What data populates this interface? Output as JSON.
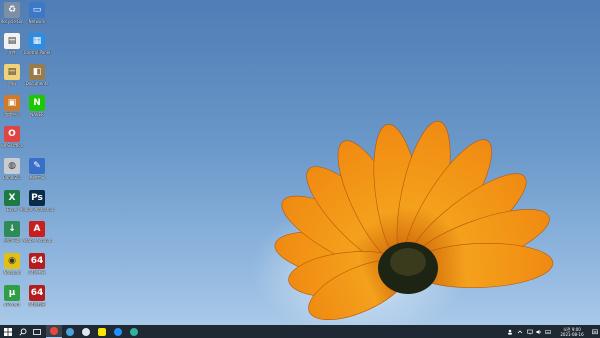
{
  "desktop": {
    "icons": [
      {
        "label": "Recycle Bin",
        "color": "#7f8fa3",
        "glyph": "♻"
      },
      {
        "label": "Network",
        "color": "#3b78c8",
        "glyph": "▭"
      },
      {
        "label": "文件",
        "color": "#f2f2f2",
        "glyph": "▤"
      },
      {
        "label": "Control Panel",
        "color": "#2d8de0",
        "glyph": "▦"
      },
      {
        "label": "资料",
        "color": "#f0d27a",
        "glyph": "▤"
      },
      {
        "label": "Documents",
        "color": "#9b7b4a",
        "glyph": "◧"
      },
      {
        "label": "游戏中心",
        "color": "#d07a2a",
        "glyph": "▣"
      },
      {
        "label": "NAVER",
        "color": "#1ec800",
        "glyph": "N"
      },
      {
        "label": "WPS Office",
        "color": "#e04444",
        "glyph": "O"
      },
      {
        "label": "BandiZip",
        "color": "#c8ccd2",
        "glyph": "◍"
      },
      {
        "label": "系统工具",
        "color": "#3a6fc8",
        "glyph": "✎"
      },
      {
        "label": "Excel",
        "color": "#1d7a44",
        "glyph": "X"
      },
      {
        "label": "Adobe Photoshop",
        "color": "#0a2b4a",
        "glyph": "Ps"
      },
      {
        "label": "应用下载",
        "color": "#2e8b57",
        "glyph": "↓"
      },
      {
        "label": "Adobe Acrobat",
        "color": "#c81e1e",
        "glyph": "A"
      },
      {
        "label": "Notepad",
        "color": "#e0c018",
        "glyph": "◉"
      },
      {
        "label": "64位工具",
        "color": "#b31d1d",
        "glyph": "64"
      },
      {
        "label": "uTorrent",
        "color": "#2f9e44",
        "glyph": "µ"
      },
      {
        "label": "64位程序",
        "color": "#b31d1d",
        "glyph": "64"
      }
    ]
  },
  "taskbar": {
    "start_icon": "windows-logo-icon",
    "search_icon": "search-icon",
    "task_view_icon": "task-view-icon",
    "apps": [
      {
        "name": "chrome-icon",
        "color": "#e8453c",
        "active": true
      },
      {
        "name": "app-icon",
        "color": "#4aa3df",
        "active": false
      },
      {
        "name": "cloud-icon",
        "color": "#dfe6ee",
        "active": false
      },
      {
        "name": "kakaotalk-icon",
        "color": "#f7e600",
        "active": false
      },
      {
        "name": "ie-icon",
        "color": "#1e90ff",
        "active": false
      },
      {
        "name": "edge-icon",
        "color": "#2fb3a0",
        "active": false
      }
    ],
    "tray": {
      "time": "오전 9:00",
      "date": "2021-08-16"
    }
  }
}
